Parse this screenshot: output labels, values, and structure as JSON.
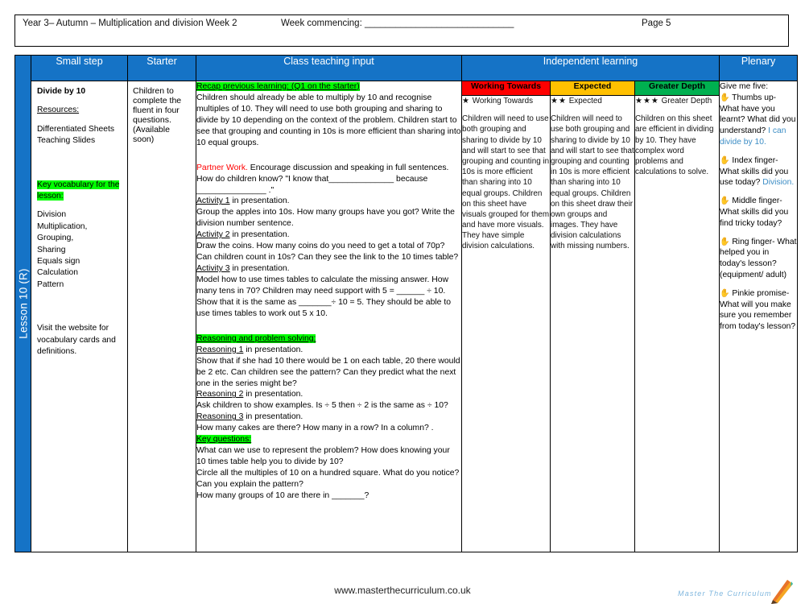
{
  "header": {
    "left": "Year 3– Autumn – Multiplication and division Week 2",
    "week_commencing_label": "Week commencing: _____________________________",
    "page": "Page 5"
  },
  "lesson_tab": {
    "label": "Lesson 10 (R)"
  },
  "columns": {
    "small_step": "Small step",
    "starter": "Starter",
    "class_teaching_input": "Class teaching input",
    "independent_learning": "Independent learning",
    "plenary": "Plenary"
  },
  "bands": {
    "working_towards": "Working Towards",
    "expected": "Expected",
    "greater_depth": "Greater Depth"
  },
  "colors": {
    "header_blue": "#1573C6",
    "working_towards": "#FF0000",
    "expected": "#FFC000",
    "greater_depth": "#00B050",
    "highlight_green": "#00FF00",
    "answer_blue": "#3C8DC5",
    "partner_work_red": "#FF0000"
  },
  "small_step": {
    "title": "Divide by 10",
    "resources_label": "Resources:",
    "resources": [
      "Differentiated Sheets",
      "Teaching Slides"
    ],
    "key_vocab_heading": "Key vocabulary for the lesson:",
    "vocab": [
      "Division",
      "Multiplication,",
      "Grouping,",
      "Sharing",
      "Equals sign",
      "Calculation",
      "Pattern"
    ],
    "footer_note": "Visit the website for vocabulary cards and definitions."
  },
  "starter": {
    "text": "Children to complete the fluent in four questions. (Available soon)"
  },
  "teaching": {
    "recap_heading": "Recap previous learning: (Q1 on the starter)",
    "recap_body": "Children should already be able to multiply by 10 and recognise multiples of 10. They will need to use both grouping and sharing to divide by 10 depending on the context of the problem. Children start to see that grouping and counting in 10s is more efficient than sharing into 10 equal groups.",
    "partner_label": "Partner Work.",
    "partner_body": " Encourage discussion and speaking in full sentences. How do children know?  \"I know that______________ because _______________ .\"",
    "activity_1_label": "Activity 1",
    "activity_1_suffix": " in presentation.",
    "activity_1_body": "Group the apples into 10s. How many groups have you got? Write the division number sentence.",
    "activity_2_label": "Activity 2",
    "activity_2_suffix": " in presentation.",
    "activity_2_body": "Draw the coins. How many coins do you need to get  a total of 70p? Can children count in 10s? Can they see the link to the 10 times table?",
    "activity_3_label": "Activity 3",
    "activity_3_suffix": " in presentation.",
    "activity_3_body": "Model how to use times tables to calculate the missing answer. How many tens in 70? Children may need support with 5 = ______ ÷ 10. Show that it is the same as _______÷ 10 = 5. They should be able to use times tables to work out 5 x 10.",
    "reasoning_heading": "Reasoning and problem solving:",
    "reasoning_1_label": "Reasoning 1",
    "reasoning_1_suffix": " in presentation.",
    "reasoning_1_body": "Show that if she had 10 there would be 1 on each table, 20 there would be 2 etc. Can children see the pattern? Can they predict what the next one in the series might be?",
    "reasoning_2_label": "Reasoning 2",
    "reasoning_2_suffix": " in presentation.",
    "reasoning_2_body": "Ask children to show examples. Is ÷ 5 then ÷ 2 is the same as ÷ 10?",
    "reasoning_3_label": "Reasoning 3",
    "reasoning_3_suffix": " in presentation.",
    "reasoning_3_body": "How many cakes are there? How many in a row? In a column? .",
    "key_questions_heading": "Key questions:",
    "key_questions": [
      "What can we use to represent the problem? How does knowing your 10 times table help you to divide by 10?",
      "Circle all the multiples of 10 on a hundred square. What do you notice? Can you explain the pattern?",
      "How many groups of 10 are there in _______?"
    ]
  },
  "independent": {
    "working_towards": {
      "stars": "★",
      "label": "Working Towards",
      "body": "Children will need to use both grouping and sharing to divide by 10 and will start to see that grouping and counting in 10s is more efficient than sharing into 10 equal groups. Children on this sheet have visuals grouped for them and have more visuals. They have simple division calculations."
    },
    "expected": {
      "stars": "★ ★",
      "label": "Expected",
      "body": "Children will need to use both grouping and sharing to divide by 10 and will start to see that grouping and counting in 10s is more efficient than sharing into 10 equal groups. Children on this sheet draw their own groups and images. They have division calculations with missing numbers."
    },
    "greater_depth": {
      "stars": "★ ★ ★",
      "label": "Greater Depth",
      "body": "Children on this sheet are efficient in dividing by 10. They have complex word problems and calculations to solve."
    }
  },
  "plenary": {
    "heading": "Give me five:",
    "items": [
      {
        "icon": "hand-icon",
        "question": "Thumbs up- What have you learnt? What did you understand?",
        "answer": "I can divide by 10."
      },
      {
        "icon": "hand-icon",
        "question": "Index finger- What skills did you use today?",
        "answer": "Division."
      },
      {
        "icon": "hand-icon",
        "question": "Middle finger- What skills did you find tricky today?",
        "answer": ""
      },
      {
        "icon": "hand-icon",
        "question": "Ring finger- What helped you in today's lesson? (equipment/ adult)",
        "answer": ""
      },
      {
        "icon": "hand-icon",
        "question": "Pinkie promise- What will you make sure you remember from today's lesson?",
        "answer": ""
      }
    ]
  },
  "footer": {
    "url": "www.masterthecurriculum.co.uk",
    "logo_text": "Master  The  Curriculum"
  }
}
